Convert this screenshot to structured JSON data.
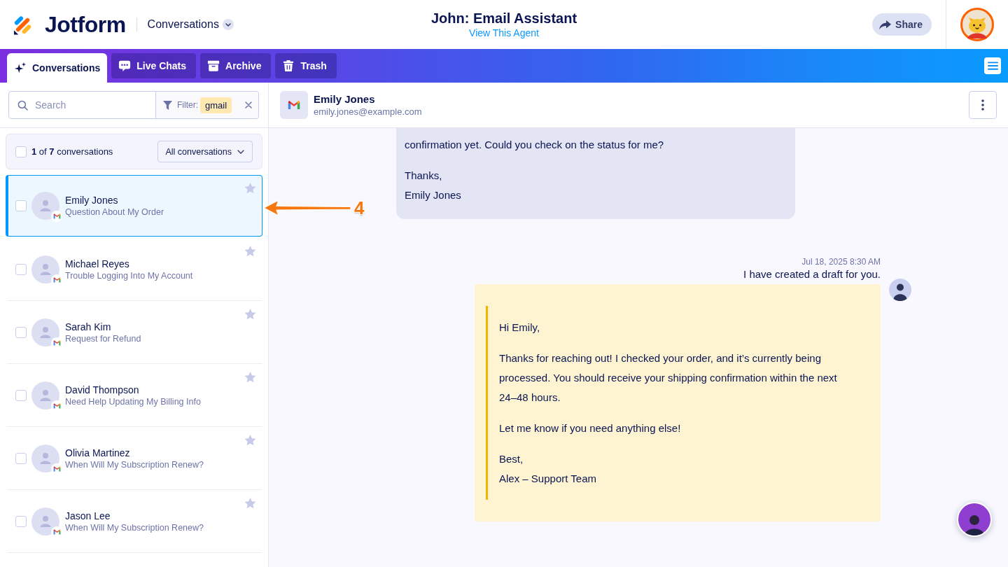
{
  "header": {
    "brand": "Jotform",
    "section": "Conversations",
    "title": "John: Email Assistant",
    "link": "View This Agent",
    "share": "Share"
  },
  "tabs": [
    {
      "label": "Conversations",
      "selected": true
    },
    {
      "label": "Live Chats",
      "selected": false
    },
    {
      "label": "Archive",
      "selected": false
    },
    {
      "label": "Trash",
      "selected": false
    }
  ],
  "search": {
    "placeholder": "Search"
  },
  "filter": {
    "label": "Filter:",
    "chip": "gmail"
  },
  "summary": {
    "checked": false,
    "text": "**1** of **7** conversations",
    "dropdown": "All conversations"
  },
  "conversations": [
    {
      "name": "Emily Jones",
      "subject": "Question About My Order",
      "selected": true,
      "checked": false,
      "starred": false
    },
    {
      "name": "Michael Reyes",
      "subject": "Trouble Logging Into My Account",
      "selected": false,
      "checked": false,
      "starred": false
    },
    {
      "name": "Sarah Kim",
      "subject": "Request for Refund",
      "selected": false,
      "checked": false,
      "starred": false
    },
    {
      "name": "David Thompson",
      "subject": "Need Help Updating My Billing Info",
      "selected": false,
      "checked": false,
      "starred": false
    },
    {
      "name": "Olivia Martinez",
      "subject": "When Will My Subscription Renew?",
      "selected": false,
      "checked": false,
      "starred": false
    },
    {
      "name": "Jason Lee",
      "subject": "When Will My Subscription Renew?",
      "selected": false,
      "checked": false,
      "starred": false
    }
  ],
  "contact": {
    "name": "Emily Jones",
    "email": "emily.jones@example.com"
  },
  "messages": [
    {
      "kind": "received",
      "paragraphs": [
        [
          "confirmation yet. Could you check on the status for me?"
        ],
        [
          "Thanks,",
          "Emily Jones"
        ]
      ]
    },
    {
      "kind": "draft",
      "time": "Jul 18, 2025 8:30 AM",
      "caption": "I have created a draft for you.",
      "paragraphs": [
        [
          "Hi Emily,"
        ],
        [
          "Thanks for reaching out! I checked your order, and it’s currently being processed. You should receive your shipping confirmation within the next 24–48 hours."
        ],
        [
          "Let me know if you need anything else!"
        ],
        [
          "Best,",
          "Alex – Support Team"
        ]
      ]
    }
  ],
  "annotation": {
    "label": "4"
  }
}
